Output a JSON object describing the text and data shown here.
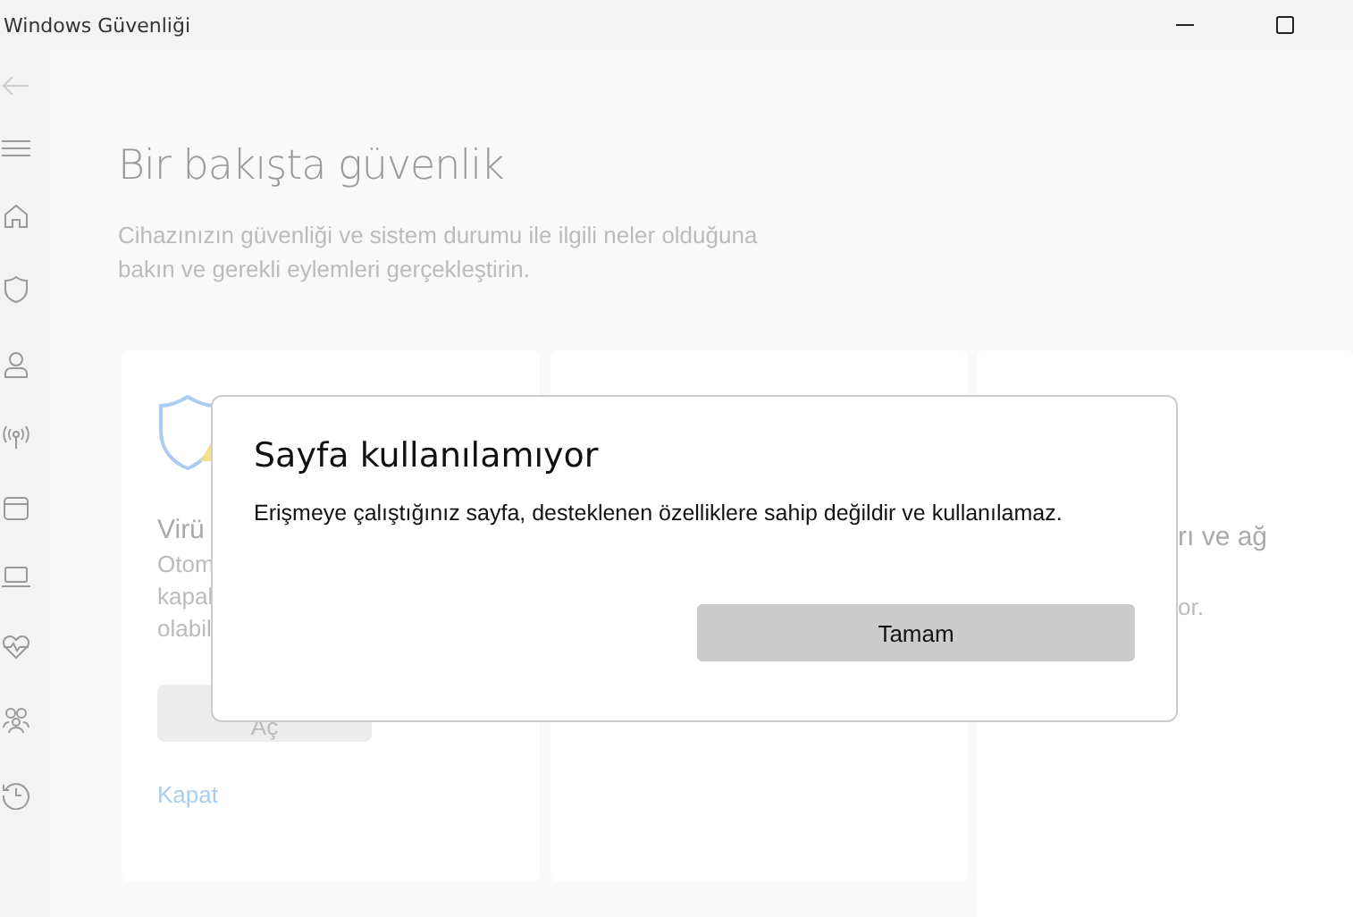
{
  "window": {
    "title": "Windows Güvenliği"
  },
  "page": {
    "title": "Bir bakışta güvenlik",
    "description": "Cihazınızın güvenliği ve sistem durumu ile ilgili neler olduğuna bakın ve gerekli eylemleri gerçekleştirin."
  },
  "virus_card": {
    "title": "Virü",
    "lines": [
      "Otom",
      "kapal",
      "olabil"
    ],
    "button": "Aç",
    "link": "Kapat"
  },
  "card_3": {
    "title": "rı ve ağ",
    "lines": [
      "or."
    ]
  },
  "dialog": {
    "title": "Sayfa kullanılamıyor",
    "message": "Erişmeye çalıştığınız sayfa, desteklenen özelliklere sahip değildir ve kullanılamaz.",
    "button": "Tamam"
  }
}
